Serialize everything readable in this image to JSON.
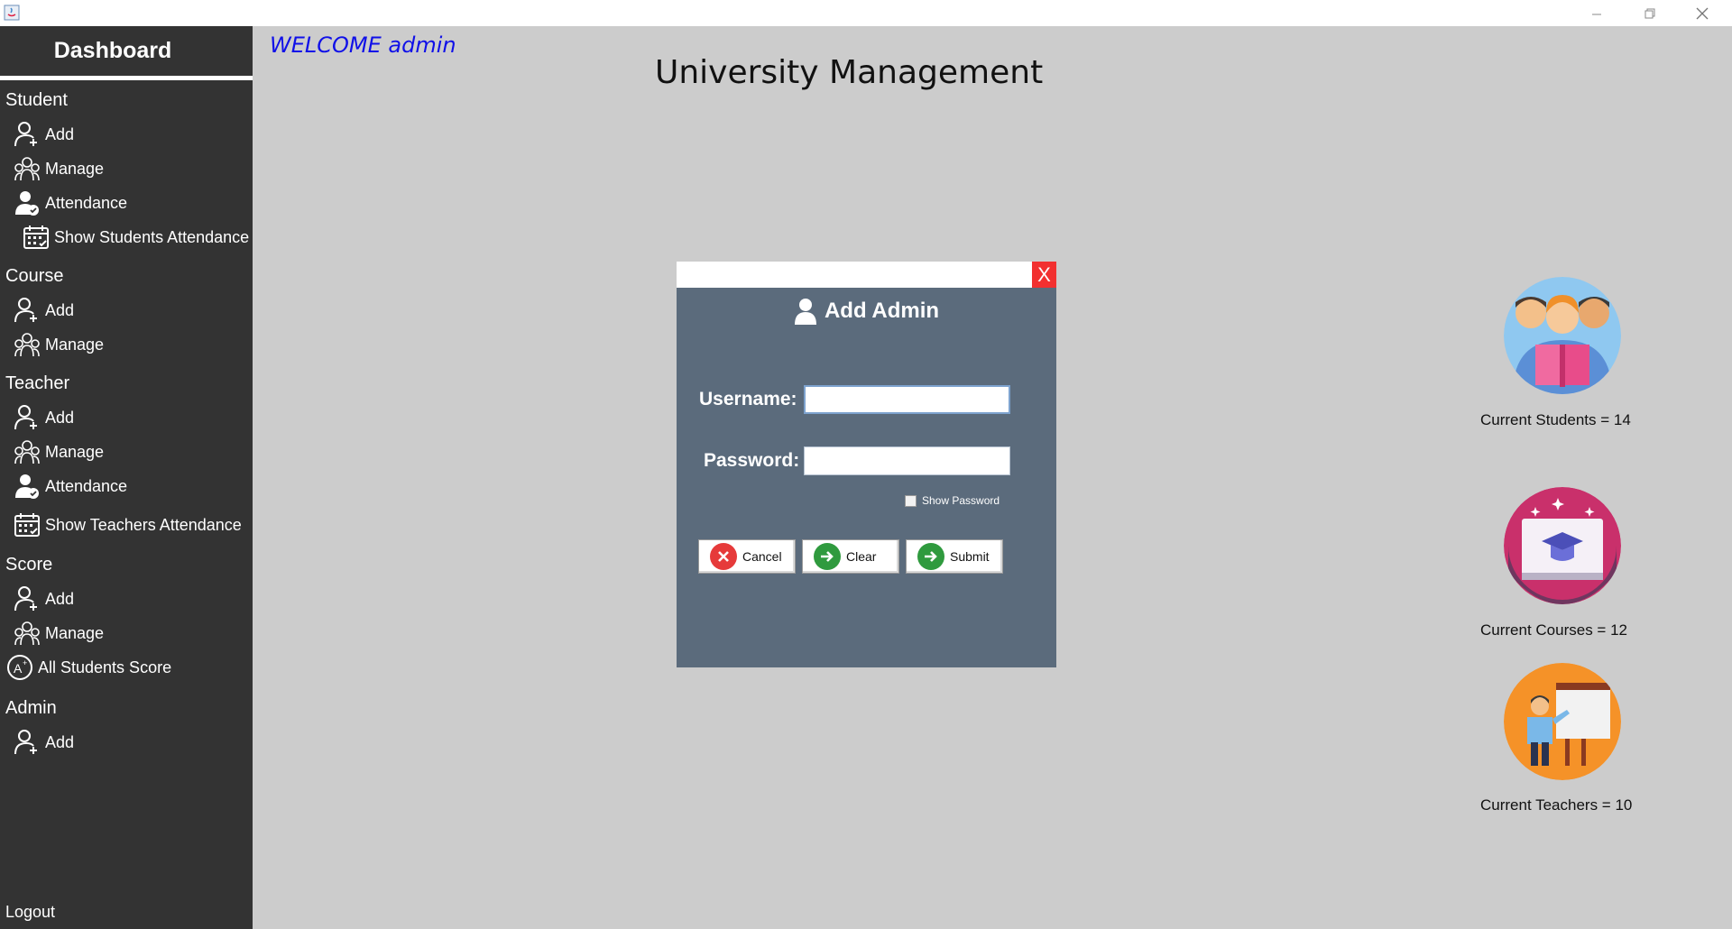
{
  "sidebar": {
    "header": "Dashboard",
    "sections": {
      "student": {
        "title": "Student",
        "items": [
          "Add",
          "Manage",
          "Attendance",
          "Show Students Attendance"
        ]
      },
      "course": {
        "title": "Course",
        "items": [
          "Add",
          "Manage"
        ]
      },
      "teacher": {
        "title": "Teacher",
        "items": [
          "Add",
          "Manage",
          "Attendance",
          "Show Teachers Attendance"
        ]
      },
      "score": {
        "title": "Score",
        "items": [
          "Add",
          "Manage",
          "All Students Score"
        ]
      },
      "admin": {
        "title": "Admin",
        "items": [
          "Add"
        ]
      }
    },
    "logout": "Logout"
  },
  "main": {
    "welcome": "WELCOME admin",
    "title": "University Management"
  },
  "dialog": {
    "close_label": "X",
    "title": "Add Admin",
    "username_label": "Username:",
    "username_value": "",
    "password_label": "Password:",
    "password_value": "",
    "show_password_label": "Show Password",
    "show_password_checked": false,
    "buttons": {
      "cancel": "Cancel",
      "clear": "Clear",
      "submit": "Submit"
    }
  },
  "stats": {
    "students": "Current Students = 14",
    "courses": "Current Courses = 12",
    "teachers": "Current Teachers = 10"
  },
  "colors": {
    "sidebar_bg": "#333333",
    "main_bg": "#cccccc",
    "dialog_bg": "#5b6b7c",
    "welcome_text": "#1010e8",
    "close_button": "#f23030"
  }
}
